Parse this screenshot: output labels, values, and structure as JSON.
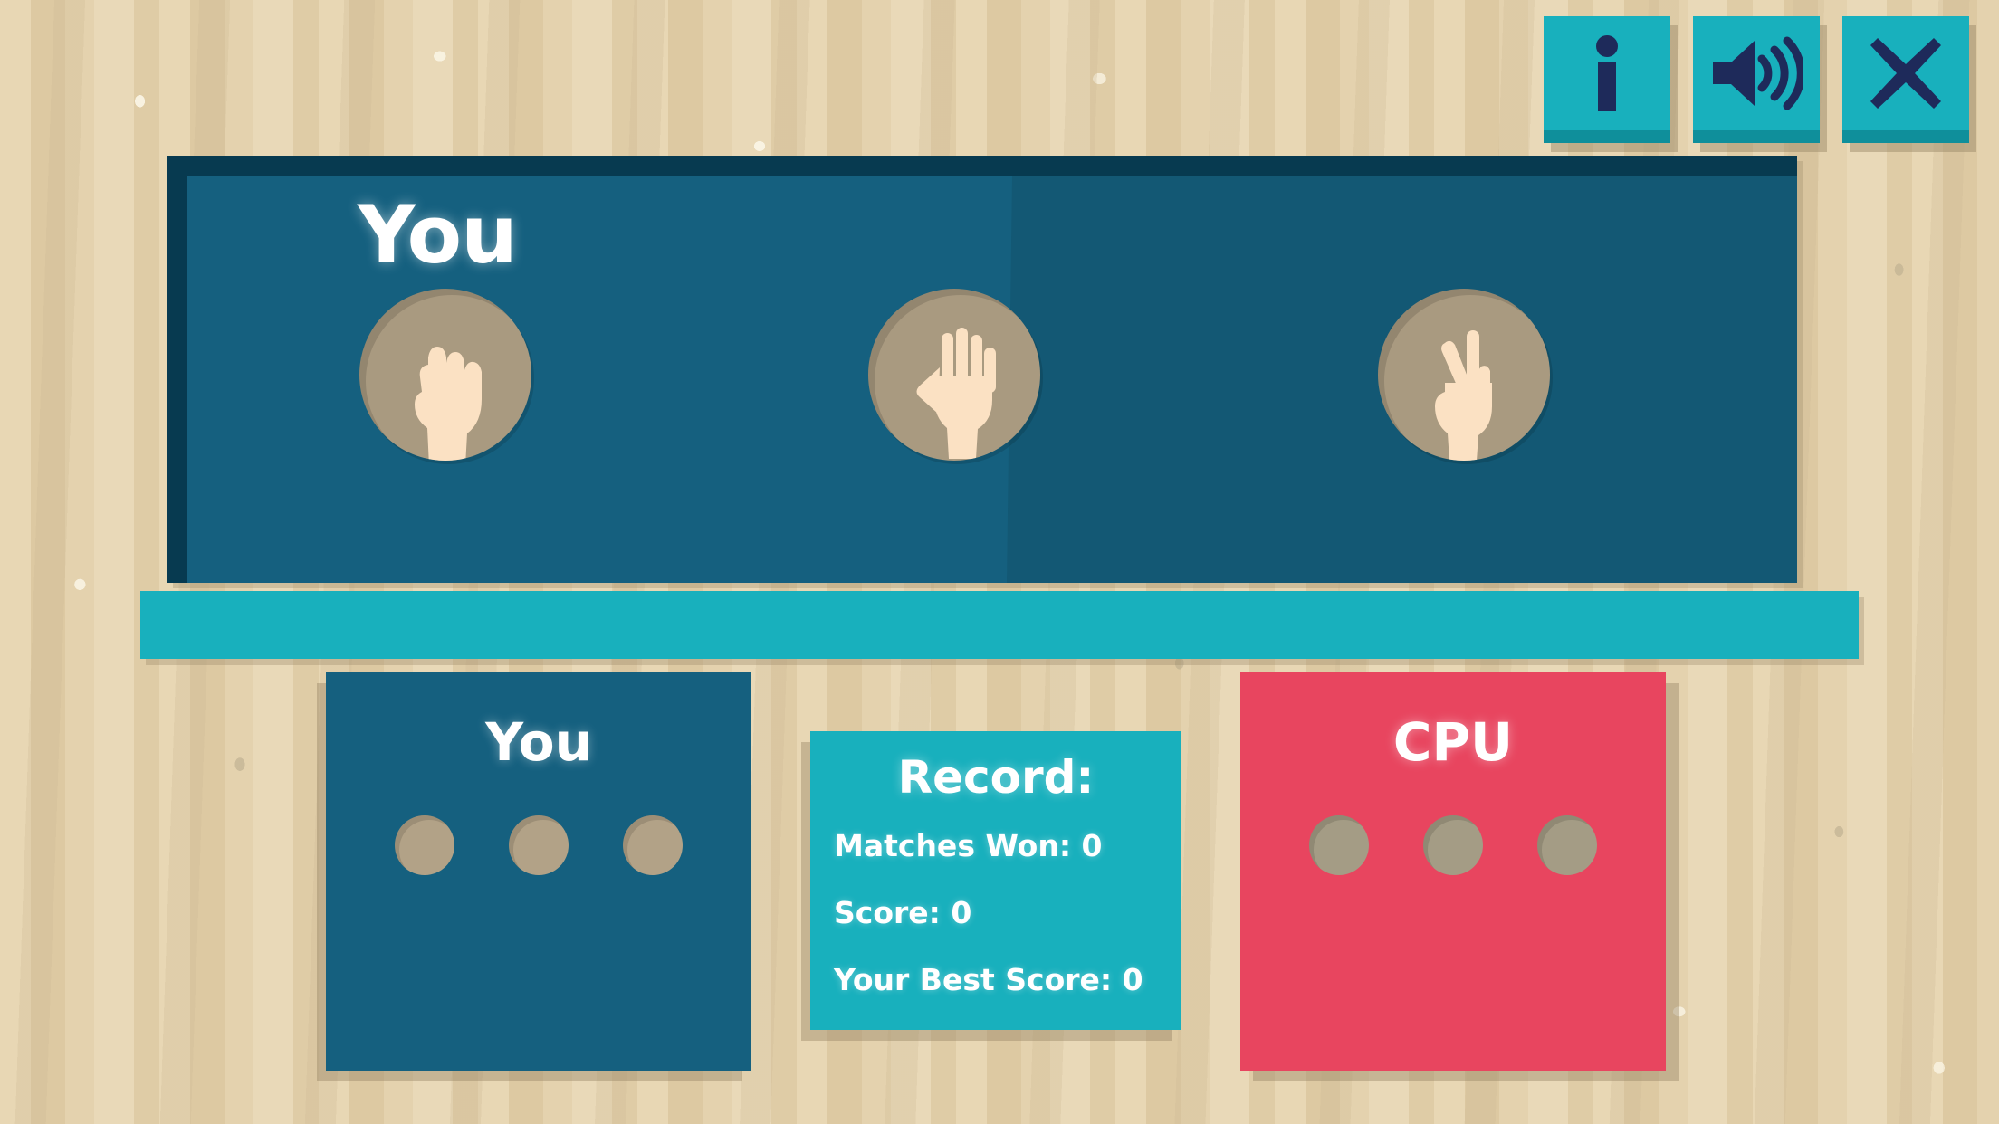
{
  "toolbar": {
    "buttons": [
      {
        "name": "info",
        "icon": "info-icon",
        "label": "Info"
      },
      {
        "name": "sound",
        "icon": "speaker-icon",
        "label": "Sound"
      },
      {
        "name": "close",
        "icon": "close-icon",
        "label": "Close"
      }
    ],
    "button_color": "#18b0bd",
    "icon_color": "#1e2a5a"
  },
  "main_panel": {
    "title": "You",
    "bg_color": "#15607f",
    "border_color": "#073a50",
    "choices": [
      {
        "id": "rock",
        "icon": "fist-icon",
        "label": "Rock"
      },
      {
        "id": "paper",
        "icon": "open-hand-icon",
        "label": "Paper"
      },
      {
        "id": "scissors",
        "icon": "peace-hand-icon",
        "label": "Scissors"
      }
    ]
  },
  "divider": {
    "color": "#18b0bd"
  },
  "you_card": {
    "title": "You",
    "bg_color": "#15607f",
    "dots": [
      "empty",
      "empty",
      "empty"
    ]
  },
  "cpu_card": {
    "title": "CPU",
    "bg_color": "#e8455f",
    "dots": [
      "empty",
      "empty",
      "empty"
    ]
  },
  "record_card": {
    "title": "Record:",
    "bg_color": "#18b0bd",
    "lines": [
      "Matches Won: 0",
      "Score: 0",
      "Your Best Score: 0"
    ],
    "matches_won": 0,
    "score": 0,
    "best_score": 0
  },
  "background": {
    "color": "#e8d7b4"
  }
}
